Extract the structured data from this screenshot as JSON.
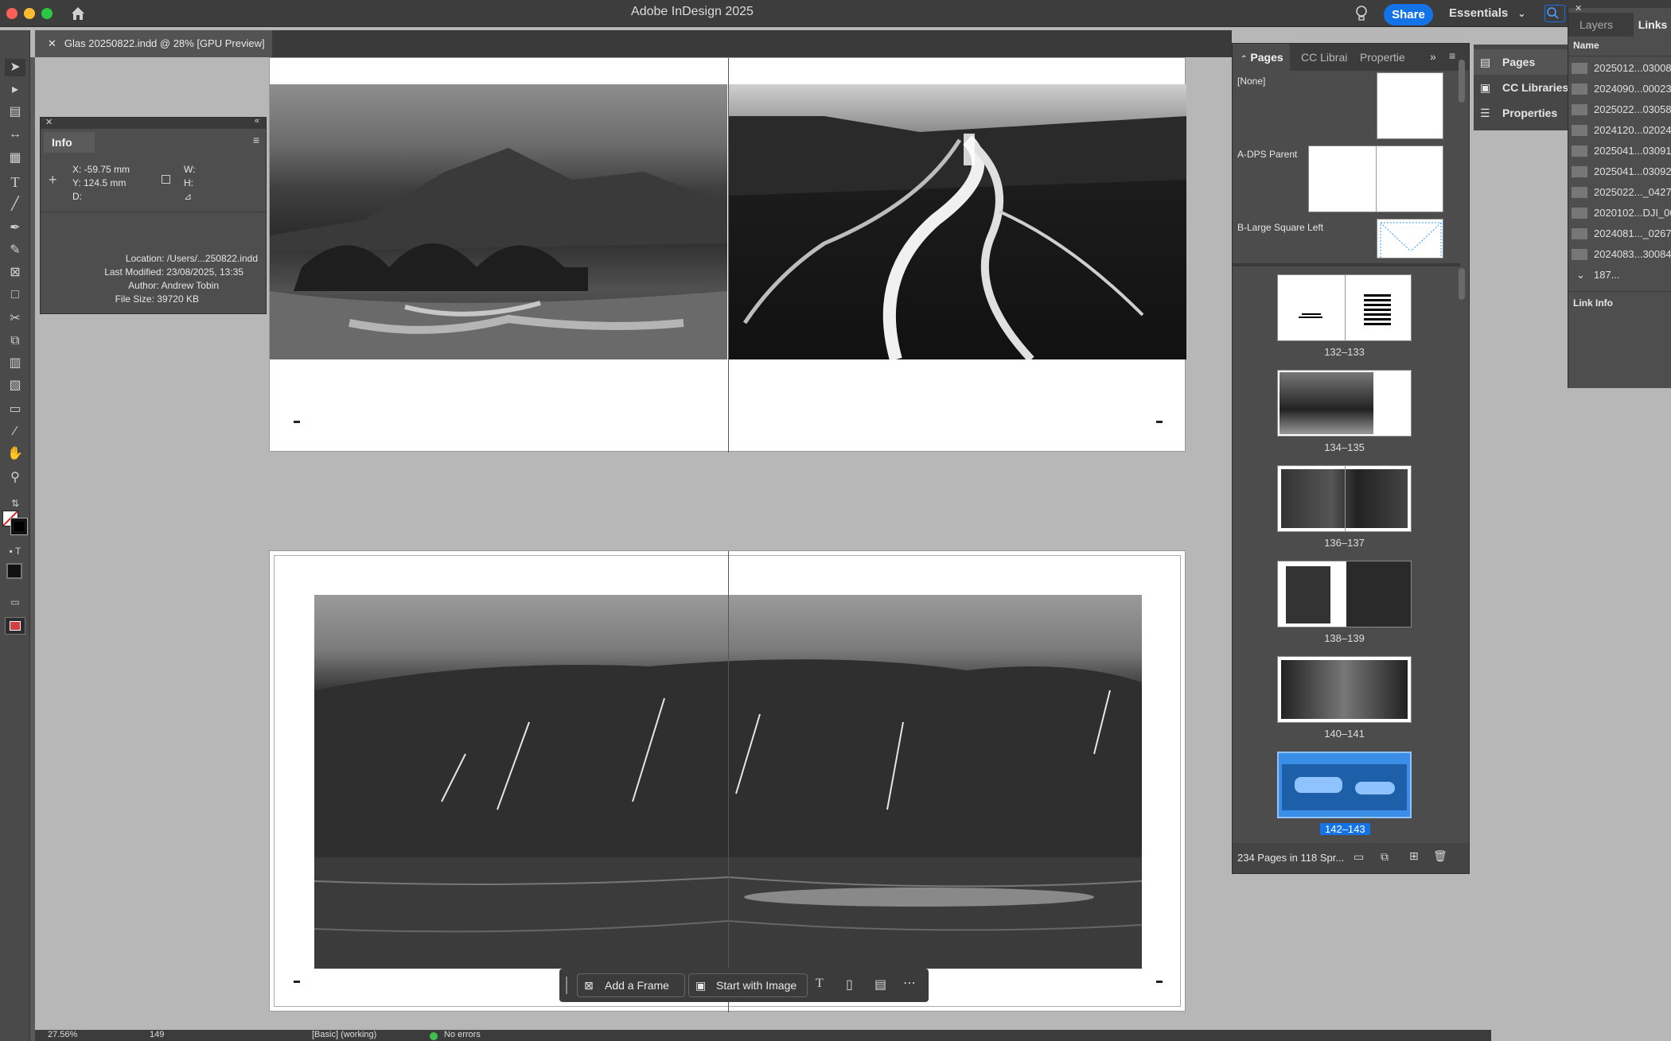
{
  "titlebar": {
    "app_title": "Adobe InDesign 2025",
    "share_label": "Share",
    "workspace_label": "Essentials"
  },
  "document_tab": {
    "label": "Glas 20250822.indd @ 28% [GPU Preview]"
  },
  "info_panel": {
    "title": "Info",
    "x": "X: -59.75 mm",
    "y": "Y: 124.5 mm",
    "d": "D:",
    "w": "W:",
    "h": "H:",
    "location": "Location: /Users/...250822.indd",
    "modified": "Last Modified: 23/08/2025, 13:35",
    "author": "Author: Andrew Tobin",
    "filesize": "File Size: 39720 KB"
  },
  "pages_panel": {
    "tabs": [
      "Pages",
      "CC Librai",
      "Propertie"
    ],
    "parents": [
      {
        "label": "[None]"
      },
      {
        "label": "A-DPS Parent"
      },
      {
        "label": "B-Large Square Left"
      }
    ],
    "spreads": [
      {
        "label": "132–133"
      },
      {
        "label": "134–135"
      },
      {
        "label": "136–137"
      },
      {
        "label": "138–139"
      },
      {
        "label": "140–141"
      },
      {
        "label": "142–143",
        "selected": true
      }
    ],
    "footer": "234 Pages in 118 Spr..."
  },
  "side_panel": {
    "items": [
      "Pages",
      "CC Libraries",
      "Properties"
    ]
  },
  "links_panel": {
    "tabs": [
      "Layers",
      "Links"
    ],
    "header": "Name",
    "items": [
      "2025012...03008",
      "2024090...00023",
      "2025022...03058",
      "2024120...02024",
      "2025041...03091",
      "2025041...03092",
      "2025022..._0427",
      "2020102...DJI_00",
      "2024081..._0267",
      "2024083...30084"
    ],
    "group": "187...",
    "link_info": "Link Info"
  },
  "context_bar": {
    "add_frame": "Add a Frame",
    "start_image": "Start with Image"
  },
  "status_bar": {
    "zoom": "27.56%",
    "page": "149",
    "preflight_profile": "[Basic] (working)",
    "errors": "No errors"
  },
  "colors": {
    "accent": "#1473e6",
    "ui_dark": "#3d3d3d",
    "panel": "#4c4c4c",
    "pasteboard": "#b7b7b7"
  }
}
